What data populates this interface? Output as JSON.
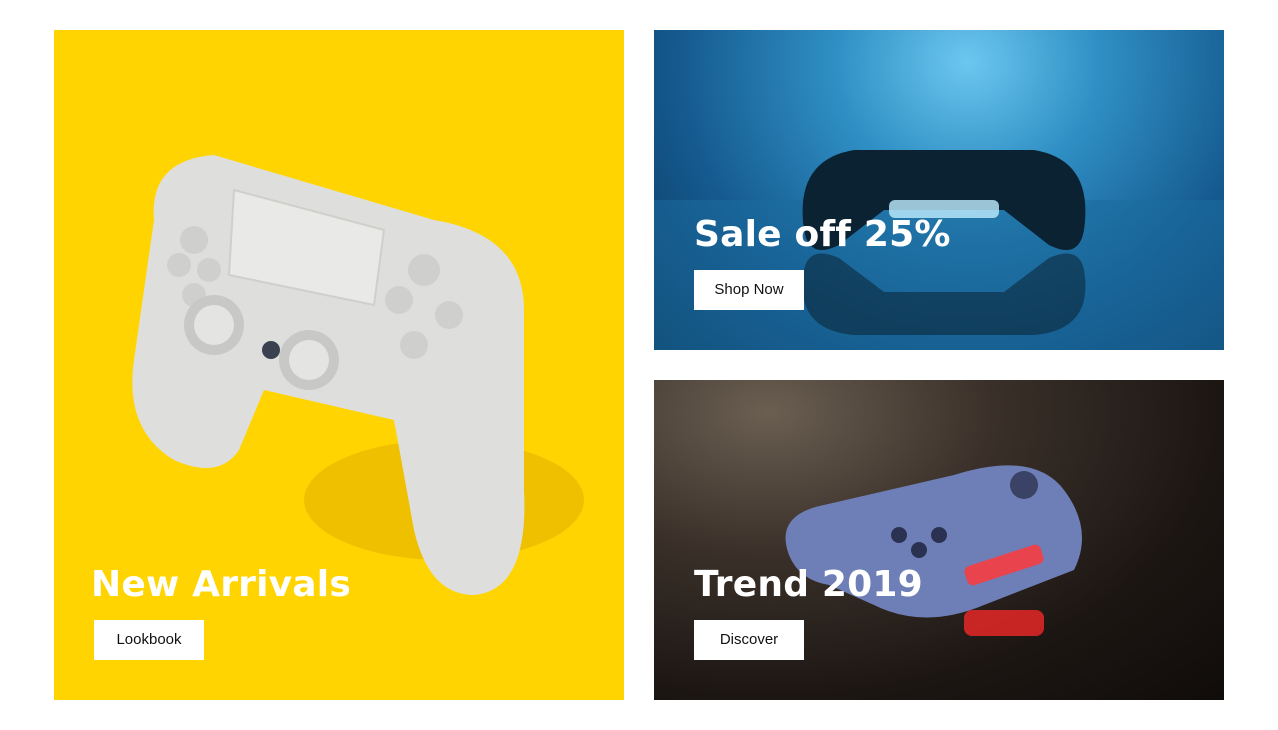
{
  "banners": [
    {
      "title": "New Arrivals",
      "button_label": "Lookbook",
      "image": "white-gamepad-image",
      "background_color": "#ffd400"
    },
    {
      "title": "Sale off 25%",
      "button_label": "Shop Now",
      "image": "blue-lit-gamepad-image",
      "background_color": "#1f6fa8"
    },
    {
      "title": "Trend 2019",
      "button_label": "Discover",
      "image": "blue-gamepad-red-light-image",
      "background_color": "#1c1613"
    }
  ]
}
